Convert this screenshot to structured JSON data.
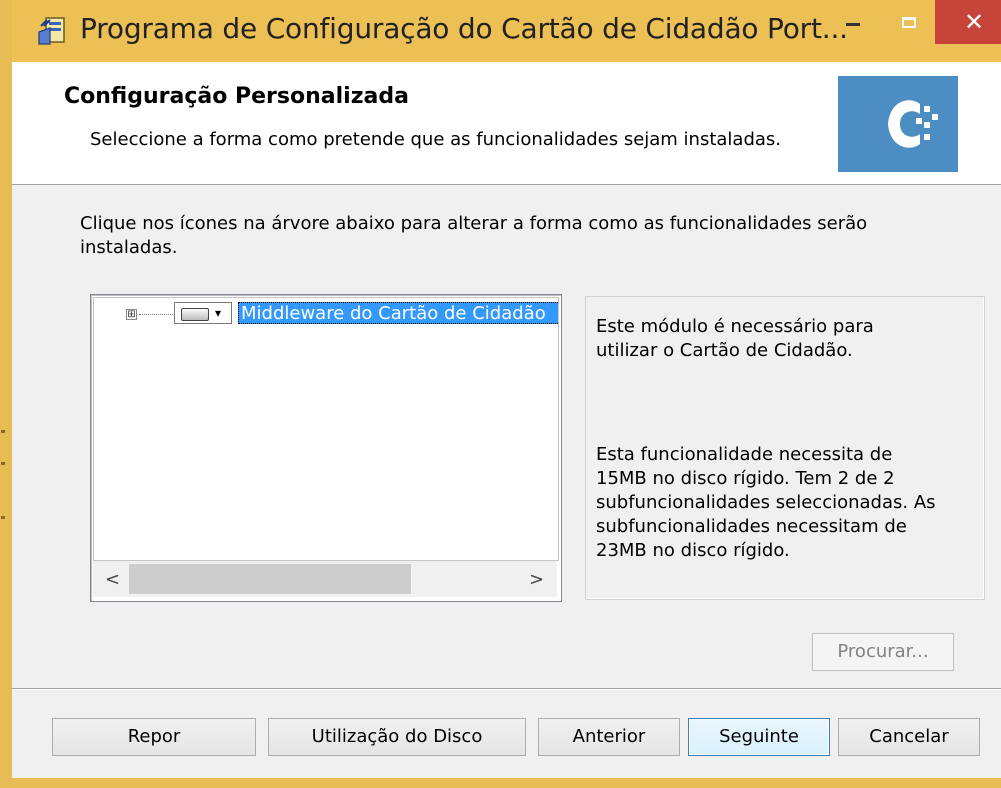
{
  "window": {
    "title": "Programa de Configuração do Cartão de Cidadão Port...",
    "close_glyph": "✕",
    "icon": "installer-icon",
    "frame_color": "#edc055",
    "close_color": "#c7443b"
  },
  "header": {
    "title": "Configuração Personalizada",
    "subtitle": "Seleccione a forma como pretende que as funcionalidades sejam instaladas.",
    "logo": "cartao-cidadao-logo",
    "logo_color": "#4c8dc3"
  },
  "instructions": "Clique nos ícones na árvore abaixo para alterar a forma como as funcionalidades serão instaladas.",
  "tree": {
    "items": [
      {
        "label": "Middleware do Cartão de Cidadão",
        "expander": "⊞",
        "dropdown_caret": "▾",
        "selected": true
      }
    ],
    "scroll_left": "<",
    "scroll_right": ">",
    "selection_color": "#3399ff"
  },
  "description": {
    "line1": "Este módulo é necessário para utilizar o Cartão de Cidadão.",
    "line2": "Esta funcionalidade necessita de 15MB no disco rígido. Tem 2 de 2 subfuncionalidades seleccionadas. As subfuncionalidades necessitam de 23MB no disco rígido."
  },
  "buttons": {
    "browse": "Procurar...",
    "reset": "Repor",
    "disk_usage": "Utilização do Disco",
    "back": "Anterior",
    "next": "Seguinte",
    "cancel": "Cancelar"
  }
}
